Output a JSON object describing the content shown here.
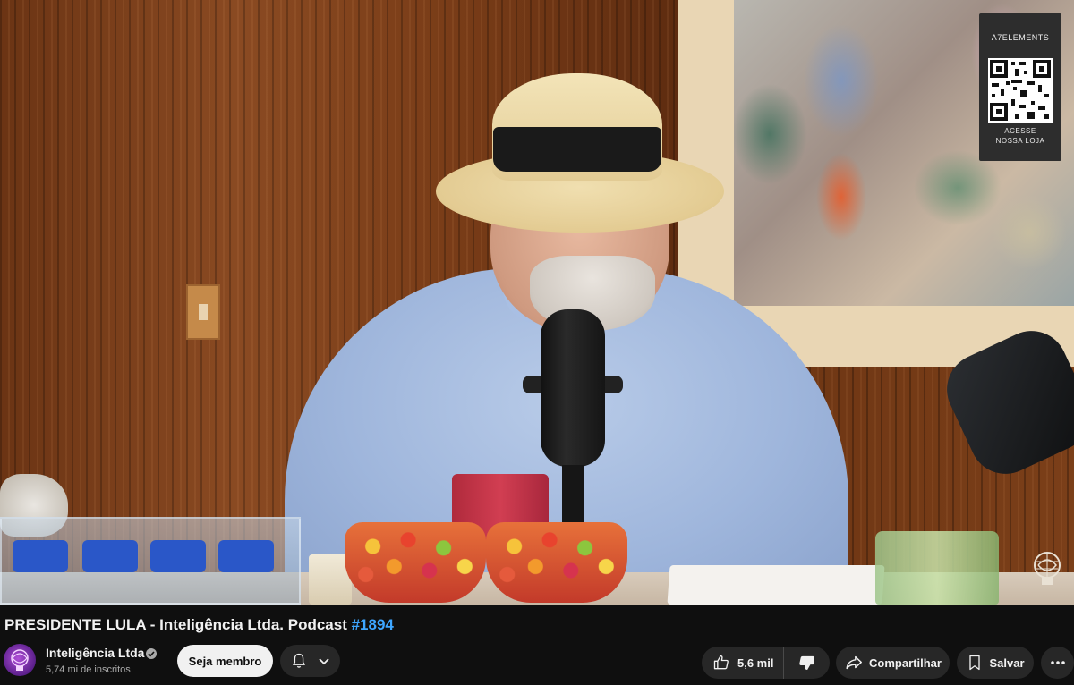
{
  "video": {
    "watermark": {
      "brand": "ELEMENTS",
      "caption": "ACESSE\nNOSSA LOJA"
    }
  },
  "title": {
    "text": "PRESIDENTE LULA - Inteligência Ltda. Podcast ",
    "hashtag": "#1894"
  },
  "channel": {
    "name": "Inteligência Ltda",
    "subscribers": "5,74 mi de inscritos"
  },
  "actions": {
    "join_label": "Seja membro",
    "like_count": "5,6 mil",
    "share_label": "Compartilhar",
    "save_label": "Salvar"
  },
  "icons": [
    "qr-code-icon",
    "channel-logo-icon",
    "verified-icon",
    "bell-icon",
    "chevron-down-icon",
    "like-icon",
    "dislike-icon",
    "share-icon",
    "save-icon",
    "more-icon"
  ],
  "colors": {
    "background": "#0f0f0f",
    "pill": "#272727",
    "hashtag": "#3ea6ff",
    "join_button": "#f1f1f1"
  }
}
